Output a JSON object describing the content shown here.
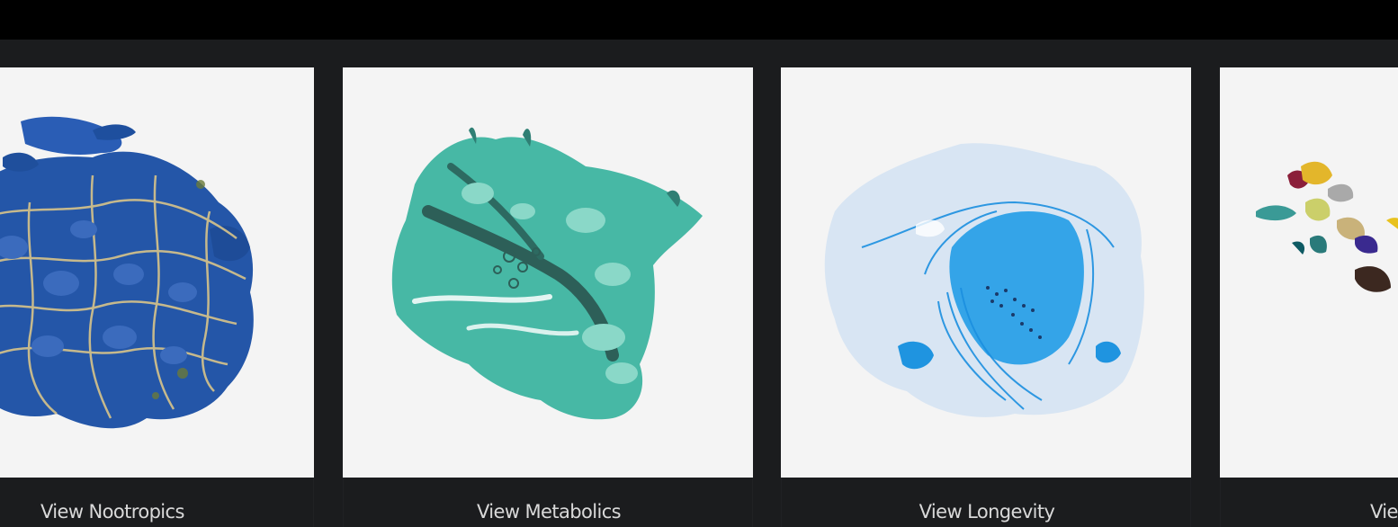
{
  "products": [
    {
      "label": "View Nootropics",
      "image": "blue-marble-artwork"
    },
    {
      "label": "View Metabolics",
      "image": "teal-marble-artwork"
    },
    {
      "label": "View Longevity",
      "image": "light-blue-watercolor-artwork"
    },
    {
      "label": "View",
      "image": "multicolor-fragments-artwork"
    }
  ],
  "colors": {
    "top_bar": "#000000",
    "background": "#1b1c1e",
    "card_image_bg": "#f4f4f4",
    "label_text": "#d9d9d9"
  }
}
